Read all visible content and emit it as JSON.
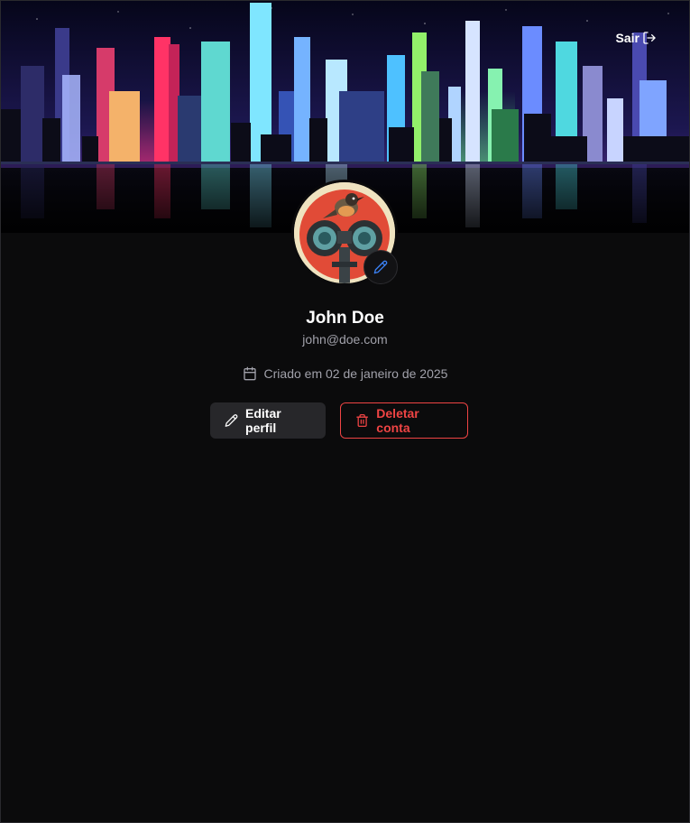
{
  "header": {
    "logout_label": "Sair",
    "logout_icon": "logout-icon"
  },
  "profile": {
    "name": "John Doe",
    "email": "john@doe.com",
    "created_label": "Criado em 02 de janeiro de 2025",
    "avatar_edit_icon": "pencil-icon",
    "created_icon": "calendar-icon"
  },
  "actions": {
    "edit_label": "Editar perfil",
    "edit_icon": "pencil-icon",
    "delete_label": "Deletar conta",
    "delete_icon": "trash-icon"
  },
  "colors": {
    "background": "#0b0b0c",
    "primary_text": "#ffffff",
    "muted_text": "#a1a1aa",
    "danger": "#ef4444",
    "secondary_button": "#27272a",
    "accent_blue": "#3b82f6"
  }
}
